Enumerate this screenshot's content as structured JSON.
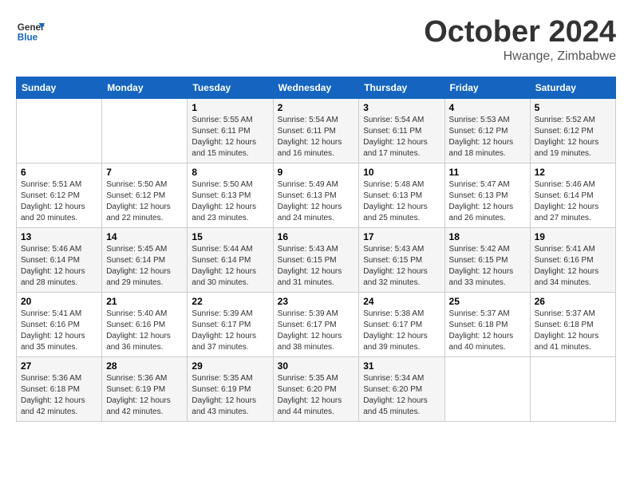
{
  "header": {
    "logo_line1": "General",
    "logo_line2": "Blue",
    "month": "October 2024",
    "location": "Hwange, Zimbabwe"
  },
  "days_of_week": [
    "Sunday",
    "Monday",
    "Tuesday",
    "Wednesday",
    "Thursday",
    "Friday",
    "Saturday"
  ],
  "weeks": [
    [
      {
        "day": "",
        "info": ""
      },
      {
        "day": "",
        "info": ""
      },
      {
        "day": "1",
        "info": "Sunrise: 5:55 AM\nSunset: 6:11 PM\nDaylight: 12 hours and 15 minutes."
      },
      {
        "day": "2",
        "info": "Sunrise: 5:54 AM\nSunset: 6:11 PM\nDaylight: 12 hours and 16 minutes."
      },
      {
        "day": "3",
        "info": "Sunrise: 5:54 AM\nSunset: 6:11 PM\nDaylight: 12 hours and 17 minutes."
      },
      {
        "day": "4",
        "info": "Sunrise: 5:53 AM\nSunset: 6:12 PM\nDaylight: 12 hours and 18 minutes."
      },
      {
        "day": "5",
        "info": "Sunrise: 5:52 AM\nSunset: 6:12 PM\nDaylight: 12 hours and 19 minutes."
      }
    ],
    [
      {
        "day": "6",
        "info": "Sunrise: 5:51 AM\nSunset: 6:12 PM\nDaylight: 12 hours and 20 minutes."
      },
      {
        "day": "7",
        "info": "Sunrise: 5:50 AM\nSunset: 6:12 PM\nDaylight: 12 hours and 22 minutes."
      },
      {
        "day": "8",
        "info": "Sunrise: 5:50 AM\nSunset: 6:13 PM\nDaylight: 12 hours and 23 minutes."
      },
      {
        "day": "9",
        "info": "Sunrise: 5:49 AM\nSunset: 6:13 PM\nDaylight: 12 hours and 24 minutes."
      },
      {
        "day": "10",
        "info": "Sunrise: 5:48 AM\nSunset: 6:13 PM\nDaylight: 12 hours and 25 minutes."
      },
      {
        "day": "11",
        "info": "Sunrise: 5:47 AM\nSunset: 6:13 PM\nDaylight: 12 hours and 26 minutes."
      },
      {
        "day": "12",
        "info": "Sunrise: 5:46 AM\nSunset: 6:14 PM\nDaylight: 12 hours and 27 minutes."
      }
    ],
    [
      {
        "day": "13",
        "info": "Sunrise: 5:46 AM\nSunset: 6:14 PM\nDaylight: 12 hours and 28 minutes."
      },
      {
        "day": "14",
        "info": "Sunrise: 5:45 AM\nSunset: 6:14 PM\nDaylight: 12 hours and 29 minutes."
      },
      {
        "day": "15",
        "info": "Sunrise: 5:44 AM\nSunset: 6:14 PM\nDaylight: 12 hours and 30 minutes."
      },
      {
        "day": "16",
        "info": "Sunrise: 5:43 AM\nSunset: 6:15 PM\nDaylight: 12 hours and 31 minutes."
      },
      {
        "day": "17",
        "info": "Sunrise: 5:43 AM\nSunset: 6:15 PM\nDaylight: 12 hours and 32 minutes."
      },
      {
        "day": "18",
        "info": "Sunrise: 5:42 AM\nSunset: 6:15 PM\nDaylight: 12 hours and 33 minutes."
      },
      {
        "day": "19",
        "info": "Sunrise: 5:41 AM\nSunset: 6:16 PM\nDaylight: 12 hours and 34 minutes."
      }
    ],
    [
      {
        "day": "20",
        "info": "Sunrise: 5:41 AM\nSunset: 6:16 PM\nDaylight: 12 hours and 35 minutes."
      },
      {
        "day": "21",
        "info": "Sunrise: 5:40 AM\nSunset: 6:16 PM\nDaylight: 12 hours and 36 minutes."
      },
      {
        "day": "22",
        "info": "Sunrise: 5:39 AM\nSunset: 6:17 PM\nDaylight: 12 hours and 37 minutes."
      },
      {
        "day": "23",
        "info": "Sunrise: 5:39 AM\nSunset: 6:17 PM\nDaylight: 12 hours and 38 minutes."
      },
      {
        "day": "24",
        "info": "Sunrise: 5:38 AM\nSunset: 6:17 PM\nDaylight: 12 hours and 39 minutes."
      },
      {
        "day": "25",
        "info": "Sunrise: 5:37 AM\nSunset: 6:18 PM\nDaylight: 12 hours and 40 minutes."
      },
      {
        "day": "26",
        "info": "Sunrise: 5:37 AM\nSunset: 6:18 PM\nDaylight: 12 hours and 41 minutes."
      }
    ],
    [
      {
        "day": "27",
        "info": "Sunrise: 5:36 AM\nSunset: 6:18 PM\nDaylight: 12 hours and 42 minutes."
      },
      {
        "day": "28",
        "info": "Sunrise: 5:36 AM\nSunset: 6:19 PM\nDaylight: 12 hours and 42 minutes."
      },
      {
        "day": "29",
        "info": "Sunrise: 5:35 AM\nSunset: 6:19 PM\nDaylight: 12 hours and 43 minutes."
      },
      {
        "day": "30",
        "info": "Sunrise: 5:35 AM\nSunset: 6:20 PM\nDaylight: 12 hours and 44 minutes."
      },
      {
        "day": "31",
        "info": "Sunrise: 5:34 AM\nSunset: 6:20 PM\nDaylight: 12 hours and 45 minutes."
      },
      {
        "day": "",
        "info": ""
      },
      {
        "day": "",
        "info": ""
      }
    ]
  ]
}
